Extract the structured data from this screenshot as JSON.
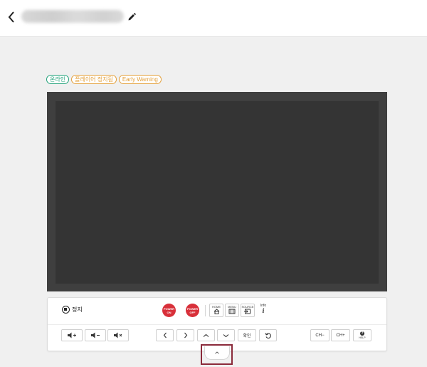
{
  "header": {
    "title": ""
  },
  "badges": {
    "online": "온라인",
    "stopped": "플레이어 정지됨",
    "warning": "Early Warning"
  },
  "controls": {
    "stop_label": "정지",
    "power_on": [
      "POWER",
      "ON"
    ],
    "power_off": [
      "POWER",
      "OFF"
    ],
    "home_label": "HOME",
    "menu_label": "MENU",
    "source_label": "SOURCE",
    "info_label": "Info",
    "info_glyph": "i",
    "confirm_label": "확인",
    "ch_down_label": "CH−",
    "ch_up_label": "CH+",
    "help_label": "HELP",
    "help_glyph": "?"
  },
  "colors": {
    "online": "#22a27a",
    "status": "#e3a03c",
    "power": "#d8303a",
    "highlight": "#8a2a3a"
  },
  "icons": {
    "back": "chevron-left-icon",
    "edit": "pencil-icon",
    "collapse": "chevron-up-icon"
  }
}
